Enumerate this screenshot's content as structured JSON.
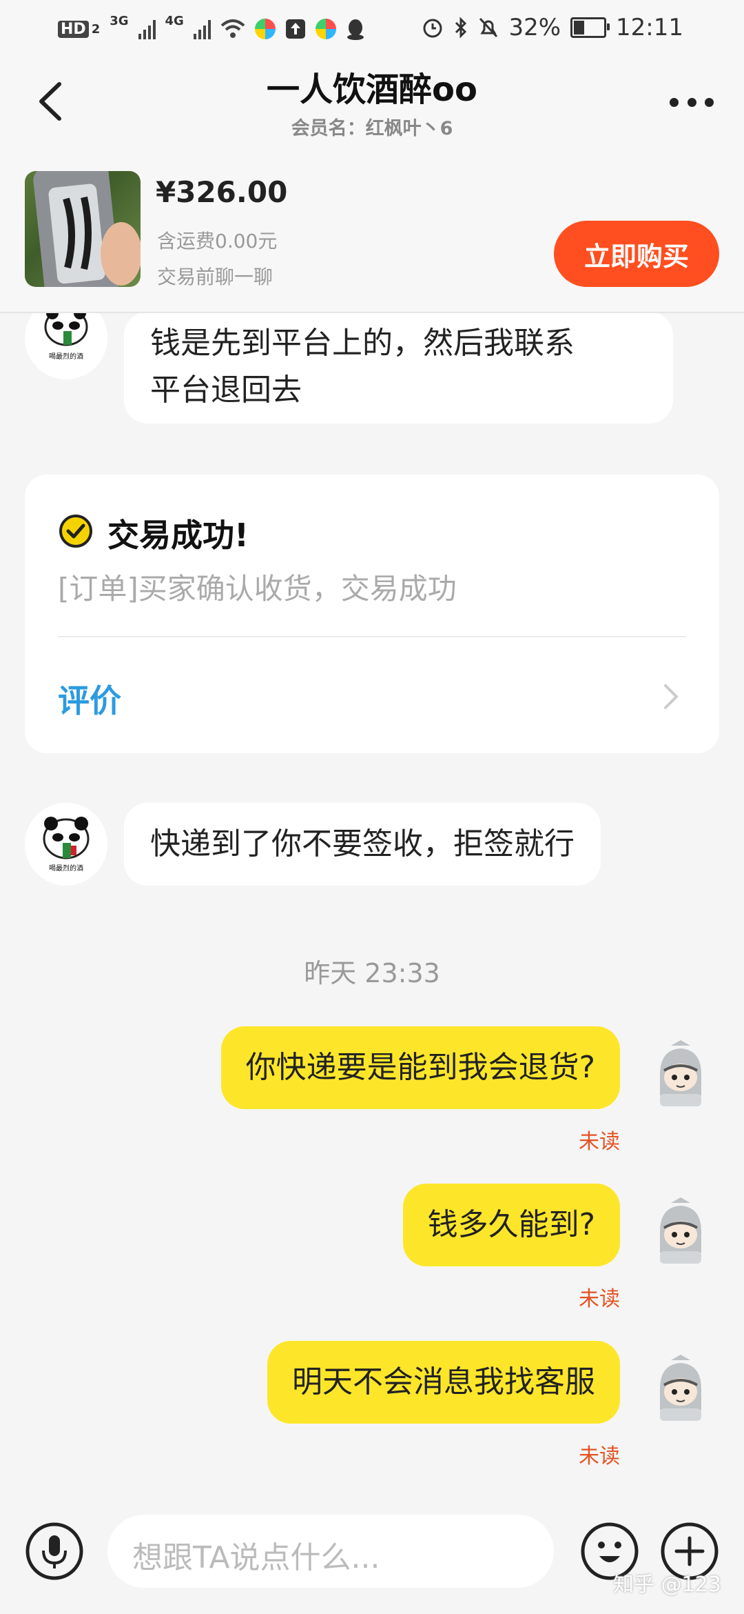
{
  "status_bar": {
    "left_labels": [
      "HD",
      "2",
      "3G",
      "4G"
    ],
    "battery": "32%",
    "battery_level": 0.32,
    "time": "12:11"
  },
  "header": {
    "title": "一人饮酒醉oo",
    "subtitle": "会员名：红枫叶丶6"
  },
  "product": {
    "price": "¥326.00",
    "shipping": "含运费0.00元",
    "note": "交易前聊一聊",
    "buy_label": "立即购买"
  },
  "messages": {
    "m1_line1": "钱是先到平台上的，然后我联系",
    "m1_line2": "平台退回去",
    "card_title": "交易成功!",
    "card_desc": "[订单]买家确认收货，交易成功",
    "card_link": "评价",
    "m2": "快递到了你不要签收，拒签就行",
    "timestamp": "昨天 23:33",
    "m3": "你快递要是能到我会退货?",
    "m4": "钱多久能到?",
    "m5": "明天不会消息我找客服",
    "unread": "未读"
  },
  "avatar_caption": "喝最烈的酒",
  "input": {
    "placeholder": "想跟TA说点什么..."
  },
  "watermark": "知乎 @123",
  "colors": {
    "accent_buy": "#ff4e1f",
    "my_bubble": "#fde62a",
    "link_blue": "#2b9be0",
    "unread_red": "#e35324",
    "success_yellow": "#f5d300"
  }
}
